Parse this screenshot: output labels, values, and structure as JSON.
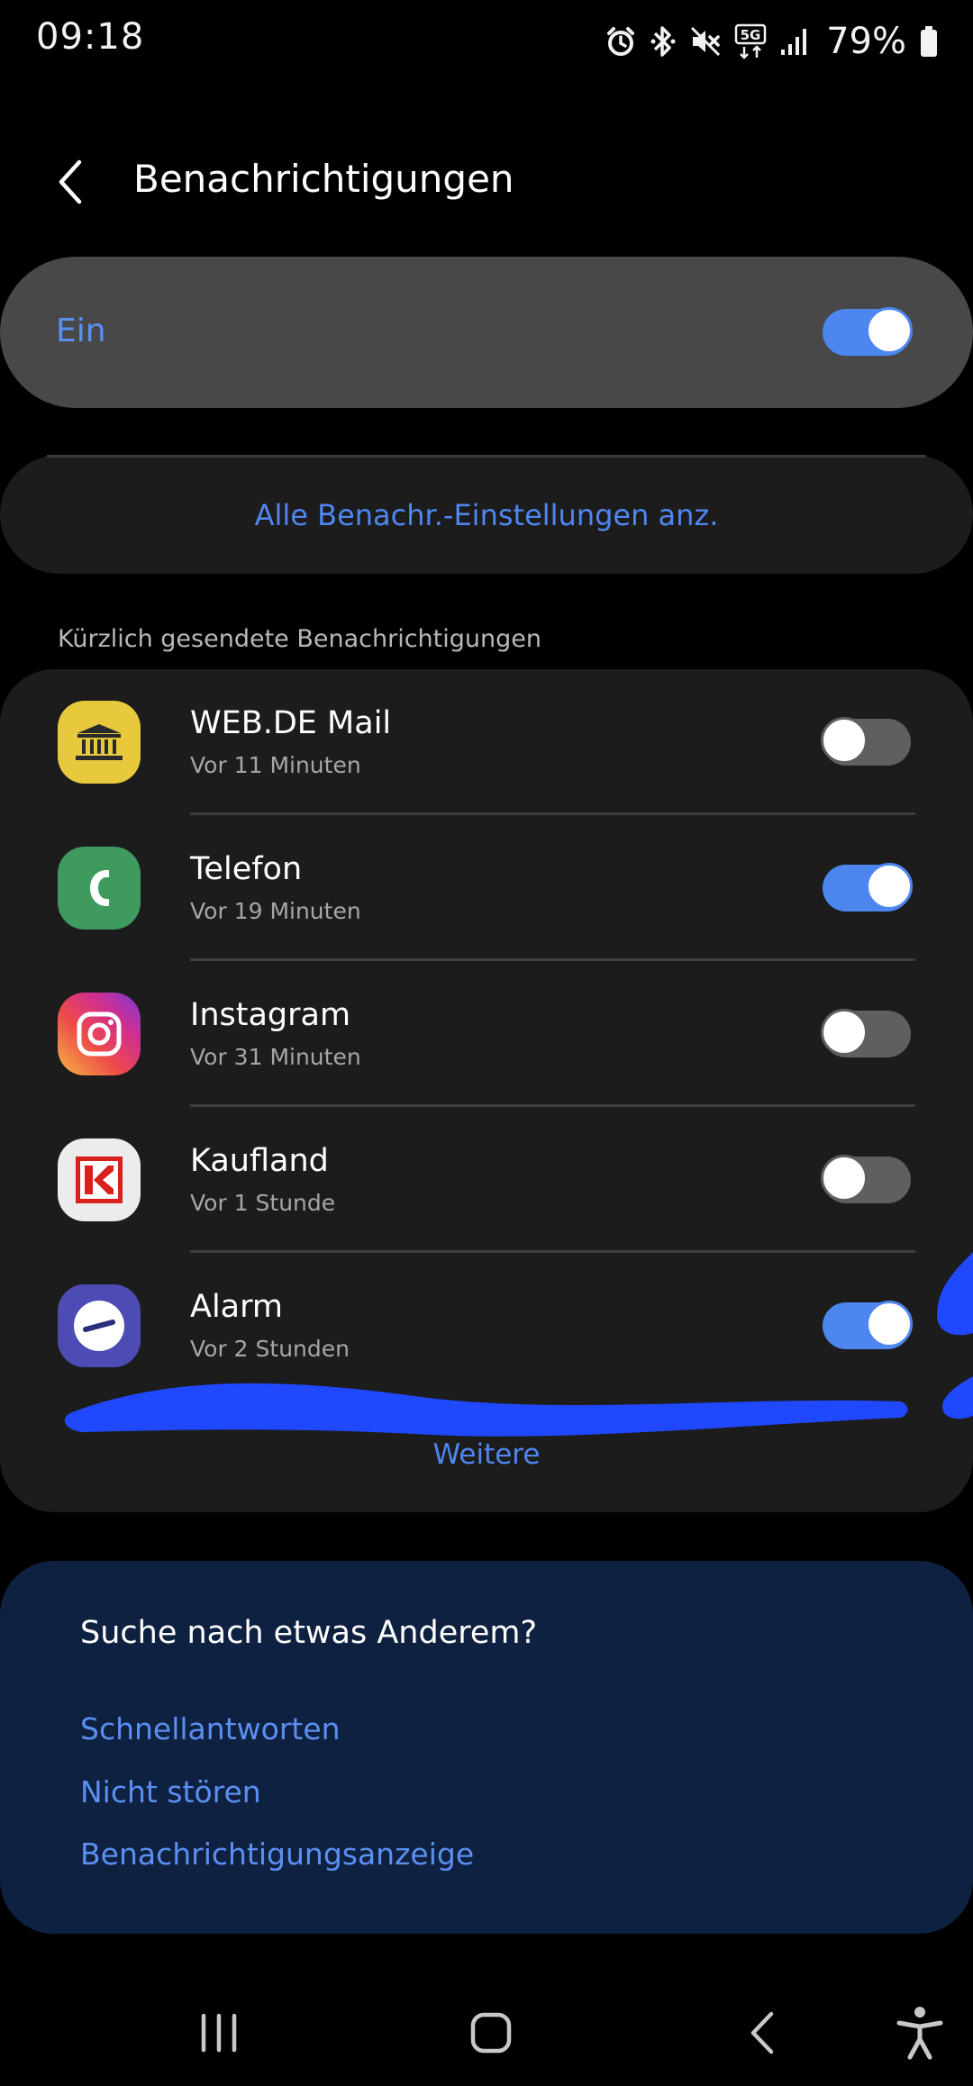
{
  "status_bar": {
    "time": "09:18",
    "network": "5G",
    "battery": "79%"
  },
  "header": {
    "title": "Benachrichtigungen"
  },
  "master": {
    "label": "Ein",
    "enabled": true
  },
  "all_settings": {
    "label": "Alle Benachr.-Einstellungen anz."
  },
  "recent": {
    "section_label": "Kürzlich gesendete Benachrichtigungen",
    "items": [
      {
        "name": "WEB.DE Mail",
        "time": "Vor 11 Minuten",
        "enabled": false,
        "icon": "webde-mail-icon"
      },
      {
        "name": "Telefon",
        "time": "Vor 19 Minuten",
        "enabled": true,
        "icon": "phone-icon"
      },
      {
        "name": "Instagram",
        "time": "Vor 31 Minuten",
        "enabled": false,
        "icon": "instagram-icon"
      },
      {
        "name": "Kaufland",
        "time": "Vor 1 Stunde",
        "enabled": false,
        "icon": "kaufland-icon"
      },
      {
        "name": "Alarm",
        "time": "Vor 2 Stunden",
        "enabled": true,
        "icon": "alarm-icon"
      }
    ],
    "more_label": "Weitere"
  },
  "help": {
    "title": "Suche nach etwas Anderem?",
    "links": [
      "Schnellantworten",
      "Nicht stören",
      "Benachrichtigungsanzeige"
    ]
  },
  "colors": {
    "accent": "#4d86ef",
    "link": "#4f86ef",
    "scribble": "#1f48ff",
    "help_background": "#0f2140"
  }
}
